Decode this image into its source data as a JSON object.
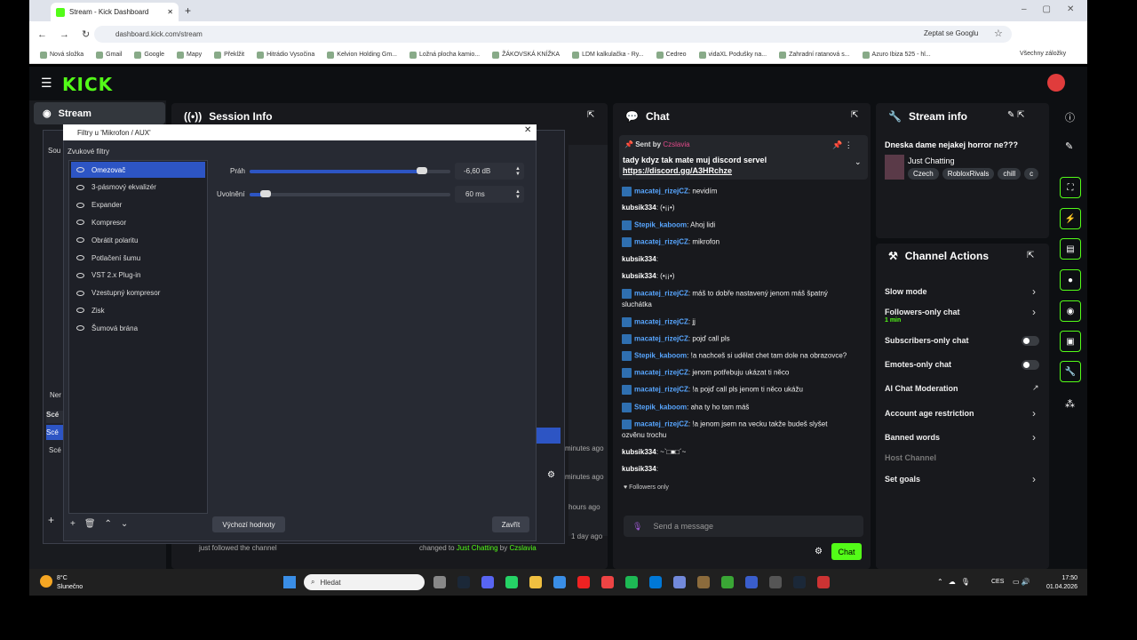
{
  "browser": {
    "tab_title": "Stream - Kick Dashboard",
    "url": "dashboard.kick.com/stream",
    "zeptat": "Zeptat se Googlu",
    "bookmarks": [
      "Nová složka",
      "Gmail",
      "Google",
      "Mapy",
      "Překlžit",
      "Hitrádio Vysočina",
      "Kelvion Holding Gm...",
      "Ložná plocha kamio...",
      "ŽÁKOVSKÁ KNÍŽKA",
      "LDM kalkulačka - Ry...",
      "Cedreo",
      "vidaXL Podušky na...",
      "Zahradní ratanová s...",
      "Azuro Ibiza 525 - hl..."
    ],
    "all_bookmarks": "Všechny záložky"
  },
  "kick": {
    "logo": "KICK",
    "sidebar_stream": "Stream",
    "session_info": "Session Info",
    "chat_title": "Chat",
    "stream_info_title": "Stream info",
    "stream_title": "Dneska dame nejakej horror ne???",
    "category": "Just Chatting",
    "tags": [
      "Czech",
      "RobloxRivals",
      "chill",
      "c"
    ],
    "channel_actions_title": "Channel Actions",
    "actions": [
      {
        "label": "Slow mode",
        "kind": "chevron"
      },
      {
        "label": "Followers-only chat",
        "sub": "1 min",
        "kind": "chevron"
      },
      {
        "label": "Subscribers-only chat",
        "kind": "toggle"
      },
      {
        "label": "Emotes-only chat",
        "kind": "toggle"
      },
      {
        "label": "AI Chat Moderation",
        "kind": "ext"
      },
      {
        "label": "Account age restriction",
        "kind": "chevron"
      },
      {
        "label": "Banned words",
        "kind": "chevron"
      },
      {
        "label": "Host Channel",
        "kind": "none"
      },
      {
        "label": "Set goals",
        "kind": "chevron"
      }
    ],
    "pinned": {
      "sent_by": "Sent by",
      "user": "Czslavia",
      "text": "tady kdyz tak mate muj discord servel",
      "link": "https://discord.gg/A3HRchze"
    },
    "messages": [
      {
        "user": "macatej_rizejCZ",
        "text": "nevidím"
      },
      {
        "user": "kubsik334",
        "text": "(•¡¡•)"
      },
      {
        "user": "Stepik_kaboom",
        "text": "Ahoj lidi"
      },
      {
        "user": "macatej_rizejCZ",
        "text": "mikrofon"
      },
      {
        "user": "kubsik334",
        "text": ""
      },
      {
        "user": "kubsik334",
        "text": "(•¡¡•)"
      },
      {
        "user": "macatej_rizejCZ",
        "text": "máš to dobře nastavený jenom máš špatný"
      },
      {
        "user": "",
        "text": "sluchátka"
      },
      {
        "user": "macatej_rizejCZ",
        "text": "jj"
      },
      {
        "user": "macatej_rizejCZ",
        "text": "pojď call pls"
      },
      {
        "user": "Stepik_kaboom",
        "text": "!a nachceš si udělat chet tam dole na obrazovce?"
      },
      {
        "user": "macatej_rizejCZ",
        "text": "jenom potřebuju ukázat ti něco"
      },
      {
        "user": "macatej_rizejCZ",
        "text": "!a pojď call pls jenom ti něco ukážu"
      },
      {
        "user": "Stepik_kaboom",
        "text": "aha ty ho tam máš"
      },
      {
        "user": "macatej_rizejCZ",
        "text": "!a jenom jsem na vecku takže budeš slyšet"
      },
      {
        "user": "",
        "text": "ozvěnu trochu"
      },
      {
        "user": "kubsik334",
        "text": "~`□■□´~"
      },
      {
        "user": "kubsik334",
        "text": ""
      }
    ],
    "followers_only": "Followers only",
    "send_placeholder": "Send a message",
    "chat_button": "Chat",
    "activity": {
      "followed": "just followed the channel",
      "changed": "changed to",
      "changed_cat": "Just Chatting",
      "changed_by": "by",
      "changed_user": "Czslavia"
    },
    "times": [
      "minutes ago",
      "minutes ago",
      "hours ago",
      "1 day ago"
    ]
  },
  "obs": {
    "title": "Filtry u 'Mikrofon / AUX'",
    "section": "Zvukové filtry",
    "filters": [
      "Omezovač",
      "3-pásmový ekvalizér",
      "Expander",
      "Kompresor",
      "Obrátit polaritu",
      "Potlačení šumu",
      "VST 2.x Plug-in",
      "Vzestupný kompresor",
      "Zisk",
      "Šumová brána"
    ],
    "selected": 0,
    "threshold_label": "Práh",
    "threshold_value": "-6,60 dB",
    "threshold_level": 0.86,
    "release_label": "Uvolnění",
    "release_value": "60 ms",
    "release_level": 0.08,
    "defaults_button": "Výchozí hodnoty",
    "close_button": "Zavřít",
    "behind": {
      "sou": "Sou",
      "ner": "Ner",
      "sce1": "Scé",
      "sce2": "Scé",
      "sce3": "Scé"
    }
  },
  "taskbar": {
    "weather_temp": "8°C",
    "weather_desc": "Slunečno",
    "search": "Hledat",
    "lang": "CES",
    "time": "17:50",
    "date": "01.04.2026"
  }
}
